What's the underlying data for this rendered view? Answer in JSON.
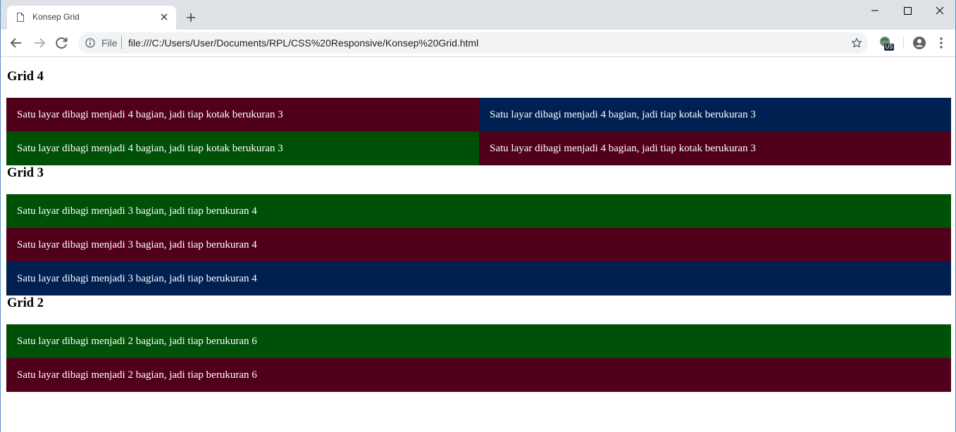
{
  "browser": {
    "tab_title": "Konsep Grid",
    "omnibox_scheme": "File",
    "url": "file:///C:/Users/User/Documents/RPL/CSS%20Responsive/Konsep%20Grid.html",
    "extension_badge": "US",
    "icons": [
      "document-icon",
      "close-icon",
      "plus-icon",
      "minimize-icon",
      "maximize-icon",
      "window-close-icon",
      "back-arrow-icon",
      "forward-arrow-icon",
      "reload-icon",
      "info-icon",
      "star-icon",
      "extension-globe-icon",
      "profile-icon",
      "menu-dots-icon"
    ]
  },
  "colors": {
    "maroon": "#51001c",
    "navy": "#002051",
    "green": "#005108"
  },
  "page": {
    "grid4": {
      "heading": "Grid 4",
      "rows": [
        [
          "Satu layar dibagi menjadi 4 bagian, jadi tiap kotak berukuran 3",
          "Satu layar dibagi menjadi 4 bagian, jadi tiap kotak berukuran 3"
        ],
        [
          "Satu layar dibagi menjadi 4 bagian, jadi tiap kotak berukuran 3",
          "Satu layar dibagi menjadi 4 bagian, jadi tiap kotak berukuran 3"
        ]
      ]
    },
    "grid3": {
      "heading": "Grid 3",
      "rows": [
        "Satu layar dibagi menjadi 3 bagian, jadi tiap berukuran 4",
        "Satu layar dibagi menjadi 3 bagian, jadi tiap berukuran 4",
        "Satu layar dibagi menjadi 3 bagian, jadi tiap berukuran 4"
      ]
    },
    "grid2": {
      "heading": "Grid 2",
      "rows": [
        "Satu layar dibagi menjadi 2 bagian, jadi tiap berukuran 6",
        "Satu layar dibagi menjadi 2 bagian, jadi tiap berukuran 6"
      ]
    }
  }
}
